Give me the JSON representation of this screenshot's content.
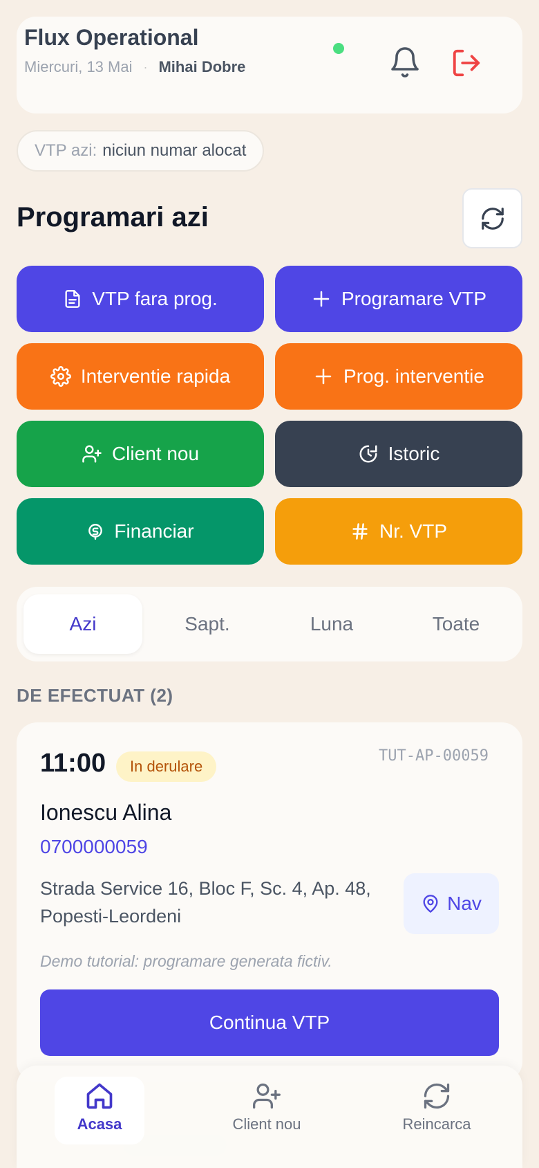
{
  "header": {
    "title": "Flux Operational",
    "date": "Miercuri, 13 Mai",
    "separator": "·",
    "user": "Mihai Dobre",
    "status_color": "#4ade80"
  },
  "vtp_today": {
    "label": "VTP azi:",
    "value": "niciun numar alocat"
  },
  "section": {
    "title": "Programari azi"
  },
  "actions": [
    {
      "label": "VTP fara prog.",
      "icon": "document-icon",
      "color": "#4f46e5"
    },
    {
      "label": "Programare VTP",
      "icon": "plus-icon",
      "color": "#4f46e5"
    },
    {
      "label": "Interventie rapida",
      "icon": "gear-icon",
      "color": "#f97316"
    },
    {
      "label": "Prog. interventie",
      "icon": "plus-icon",
      "color": "#f97316"
    },
    {
      "label": "Client nou",
      "icon": "user-plus-icon",
      "color": "#16a34a"
    },
    {
      "label": "Istoric",
      "icon": "history-icon",
      "color": "#374151"
    },
    {
      "label": "Financiar",
      "icon": "coin-icon",
      "color": "#059669"
    },
    {
      "label": "Nr. VTP",
      "icon": "hash-icon",
      "color": "#f59e0b"
    }
  ],
  "tabs": [
    {
      "label": "Azi",
      "active": true
    },
    {
      "label": "Sapt.",
      "active": false
    },
    {
      "label": "Luna",
      "active": false
    },
    {
      "label": "Toate",
      "active": false
    }
  ],
  "group": {
    "label": "DE EFECTUAT (2)"
  },
  "appointment": {
    "time": "11:00",
    "status": "In derulare",
    "code": "TUT-AP-00059",
    "client": "Ionescu Alina",
    "phone": "0700000059",
    "address": "Strada Service 16, Bloc F, Sc. 4, Ap. 48, Popesti-Leordeni",
    "nav_label": "Nav",
    "note": "Demo tutorial: programare generata fictiv.",
    "cta": "Continua VTP"
  },
  "bottom_nav": [
    {
      "label": "Acasa",
      "icon": "home-icon",
      "active": true
    },
    {
      "label": "Client nou",
      "icon": "user-plus-icon",
      "active": false
    },
    {
      "label": "Reincarca",
      "icon": "refresh-icon",
      "active": false
    }
  ]
}
